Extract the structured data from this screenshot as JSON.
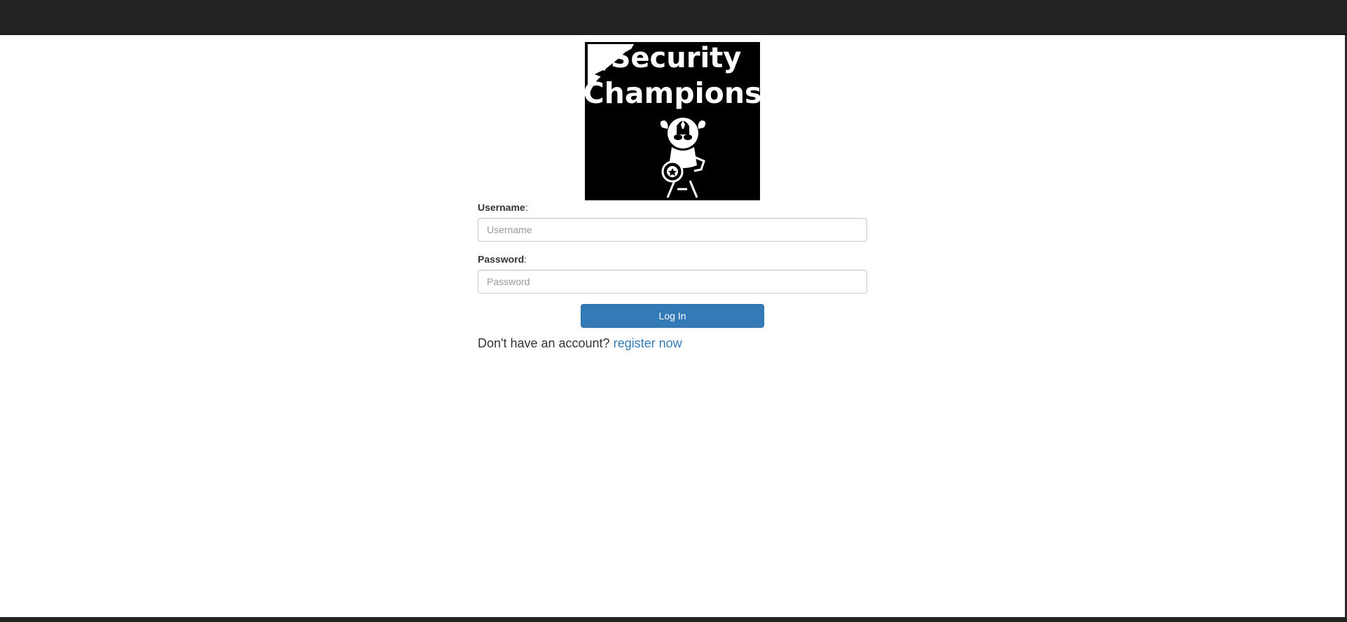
{
  "logo": {
    "line1": "Security",
    "line2": "Champions",
    "alt": "Security Champions"
  },
  "form": {
    "username": {
      "label_bold": "Username",
      "label_suffix": ":",
      "placeholder": "Username",
      "value": ""
    },
    "password": {
      "label_bold": "Password",
      "label_suffix": ":",
      "placeholder": "Password",
      "value": ""
    },
    "submit_label": "Log In"
  },
  "register": {
    "prompt": "Don't have an account?",
    "link_text": "register now"
  },
  "colors": {
    "navbar": "#222222",
    "primary": "#337ab7",
    "link": "#337ab7",
    "text": "#333333"
  }
}
